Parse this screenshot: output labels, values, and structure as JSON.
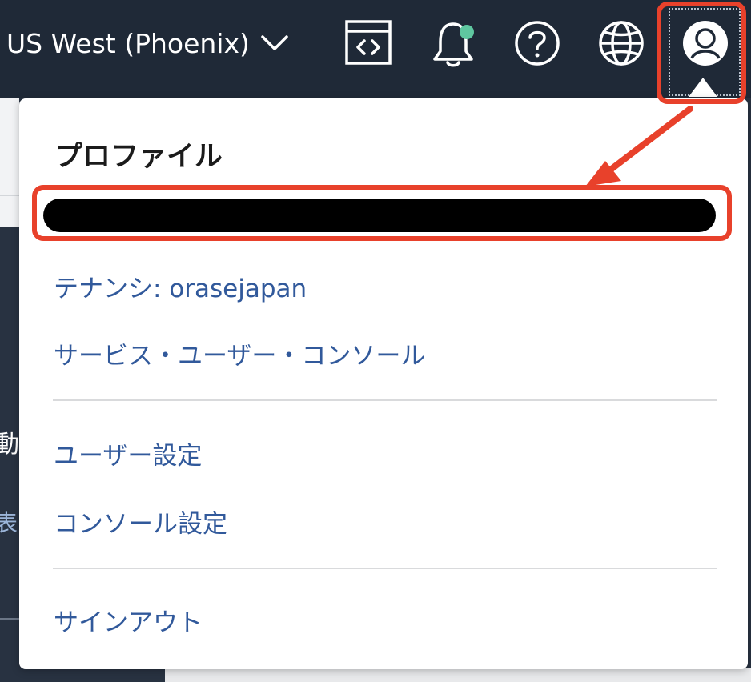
{
  "header": {
    "region_label": "US West (Phoenix)",
    "icons": {
      "code_editor": "code-editor-icon",
      "notifications": "bell-icon",
      "help": "help-icon",
      "language": "globe-icon",
      "profile": "profile-icon"
    },
    "notification_dot_color": "#5fc7a0"
  },
  "profile_menu": {
    "title": "プロファイル",
    "tenancy": "テナンシ: orasejapan",
    "service_user_console": "サービス・ユーザー・コンソール",
    "user_settings": "ユーザー設定",
    "console_settings": "コンソール設定",
    "sign_out": "サインアウト"
  },
  "background": {
    "char_1": "動",
    "char_2": "表"
  },
  "colors": {
    "header_bg": "#1f2937",
    "link": "#31599b",
    "highlight": "#e8412b"
  }
}
